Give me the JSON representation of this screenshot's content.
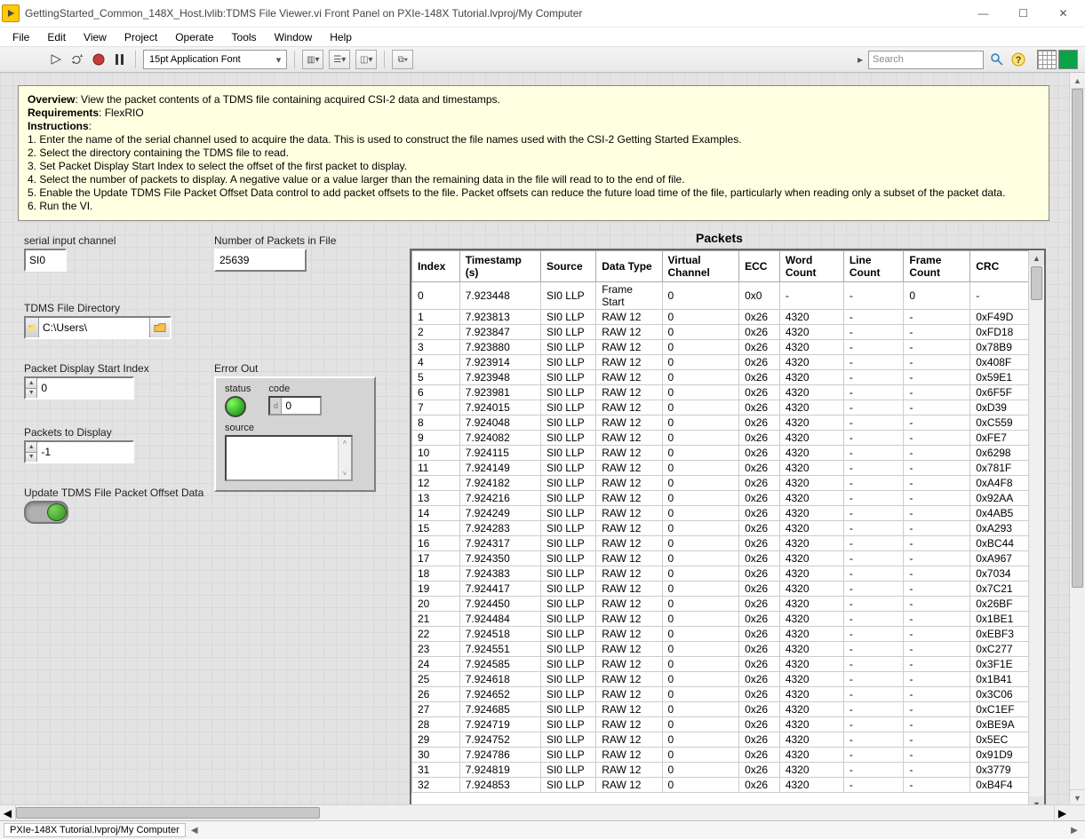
{
  "window": {
    "title": "GettingStarted_Common_148X_Host.lvlib:TDMS File Viewer.vi Front Panel on PXIe-148X Tutorial.lvproj/My Computer"
  },
  "menu": [
    "File",
    "Edit",
    "View",
    "Project",
    "Operate",
    "Tools",
    "Window",
    "Help"
  ],
  "toolbar": {
    "font": "15pt Application Font",
    "search_ph": "Search"
  },
  "overview": {
    "ov_line": "View the packet contents of a TDMS file containing acquired CSI-2 data and timestamps.",
    "req_line": "FlexRIO",
    "steps": [
      "1. Enter the name of the serial channel used to acquire the data.  This is used to construct the file names used with the CSI-2 Getting Started Examples.",
      "2. Select the directory containing the TDMS file to read.",
      "3. Set Packet Display Start Index to select the offset of the first packet to display.",
      "4. Select the number of packets to display.  A negative value or a value larger than the remaining data in the file will read to to the end of file.",
      "5. Enable the Update TDMS File Packet Offset Data control to add packet offsets to the file. Packet offsets can reduce the future load time of the file, particularly when reading only a subset of the packet data.",
      "6. Run the VI."
    ]
  },
  "labels": {
    "serial": "serial input channel",
    "numpkts": "Number of Packets in File",
    "tdmsdir": "TDMS File Directory",
    "startidx": "Packet Display Start Index",
    "pkts2disp": "Packets to Display",
    "update": "Update TDMS File Packet Offset Data",
    "errout": "Error Out",
    "status": "status",
    "code": "code",
    "source": "source",
    "packets": "Packets"
  },
  "values": {
    "serial": "SI0",
    "numpkts": "25639",
    "tdmsdir": "C:\\Users\\",
    "startidx": "0",
    "pkts2disp": "-1",
    "code": "0",
    "code_prefix": "d"
  },
  "table": {
    "headers": [
      "Index",
      "Timestamp (s)",
      "Source",
      "Data Type",
      "Virtual Channel",
      "ECC",
      "Word Count",
      "Line Count",
      "Frame Count",
      "CRC"
    ],
    "rows": [
      [
        "0",
        "7.923448",
        "SI0 LLP",
        "Frame Start",
        "0",
        "0x0",
        "-",
        "-",
        "0",
        "-"
      ],
      [
        "1",
        "7.923813",
        "SI0 LLP",
        "RAW 12",
        "0",
        "0x26",
        "4320",
        "-",
        "-",
        "0xF49D"
      ],
      [
        "2",
        "7.923847",
        "SI0 LLP",
        "RAW 12",
        "0",
        "0x26",
        "4320",
        "-",
        "-",
        "0xFD18"
      ],
      [
        "3",
        "7.923880",
        "SI0 LLP",
        "RAW 12",
        "0",
        "0x26",
        "4320",
        "-",
        "-",
        "0x78B9"
      ],
      [
        "4",
        "7.923914",
        "SI0 LLP",
        "RAW 12",
        "0",
        "0x26",
        "4320",
        "-",
        "-",
        "0x408F"
      ],
      [
        "5",
        "7.923948",
        "SI0 LLP",
        "RAW 12",
        "0",
        "0x26",
        "4320",
        "-",
        "-",
        "0x59E1"
      ],
      [
        "6",
        "7.923981",
        "SI0 LLP",
        "RAW 12",
        "0",
        "0x26",
        "4320",
        "-",
        "-",
        "0x6F5F"
      ],
      [
        "7",
        "7.924015",
        "SI0 LLP",
        "RAW 12",
        "0",
        "0x26",
        "4320",
        "-",
        "-",
        "0xD39"
      ],
      [
        "8",
        "7.924048",
        "SI0 LLP",
        "RAW 12",
        "0",
        "0x26",
        "4320",
        "-",
        "-",
        "0xC559"
      ],
      [
        "9",
        "7.924082",
        "SI0 LLP",
        "RAW 12",
        "0",
        "0x26",
        "4320",
        "-",
        "-",
        "0xFE7"
      ],
      [
        "10",
        "7.924115",
        "SI0 LLP",
        "RAW 12",
        "0",
        "0x26",
        "4320",
        "-",
        "-",
        "0x6298"
      ],
      [
        "11",
        "7.924149",
        "SI0 LLP",
        "RAW 12",
        "0",
        "0x26",
        "4320",
        "-",
        "-",
        "0x781F"
      ],
      [
        "12",
        "7.924182",
        "SI0 LLP",
        "RAW 12",
        "0",
        "0x26",
        "4320",
        "-",
        "-",
        "0xA4F8"
      ],
      [
        "13",
        "7.924216",
        "SI0 LLP",
        "RAW 12",
        "0",
        "0x26",
        "4320",
        "-",
        "-",
        "0x92AA"
      ],
      [
        "14",
        "7.924249",
        "SI0 LLP",
        "RAW 12",
        "0",
        "0x26",
        "4320",
        "-",
        "-",
        "0x4AB5"
      ],
      [
        "15",
        "7.924283",
        "SI0 LLP",
        "RAW 12",
        "0",
        "0x26",
        "4320",
        "-",
        "-",
        "0xA293"
      ],
      [
        "16",
        "7.924317",
        "SI0 LLP",
        "RAW 12",
        "0",
        "0x26",
        "4320",
        "-",
        "-",
        "0xBC44"
      ],
      [
        "17",
        "7.924350",
        "SI0 LLP",
        "RAW 12",
        "0",
        "0x26",
        "4320",
        "-",
        "-",
        "0xA967"
      ],
      [
        "18",
        "7.924383",
        "SI0 LLP",
        "RAW 12",
        "0",
        "0x26",
        "4320",
        "-",
        "-",
        "0x7034"
      ],
      [
        "19",
        "7.924417",
        "SI0 LLP",
        "RAW 12",
        "0",
        "0x26",
        "4320",
        "-",
        "-",
        "0x7C21"
      ],
      [
        "20",
        "7.924450",
        "SI0 LLP",
        "RAW 12",
        "0",
        "0x26",
        "4320",
        "-",
        "-",
        "0x26BF"
      ],
      [
        "21",
        "7.924484",
        "SI0 LLP",
        "RAW 12",
        "0",
        "0x26",
        "4320",
        "-",
        "-",
        "0x1BE1"
      ],
      [
        "22",
        "7.924518",
        "SI0 LLP",
        "RAW 12",
        "0",
        "0x26",
        "4320",
        "-",
        "-",
        "0xEBF3"
      ],
      [
        "23",
        "7.924551",
        "SI0 LLP",
        "RAW 12",
        "0",
        "0x26",
        "4320",
        "-",
        "-",
        "0xC277"
      ],
      [
        "24",
        "7.924585",
        "SI0 LLP",
        "RAW 12",
        "0",
        "0x26",
        "4320",
        "-",
        "-",
        "0x3F1E"
      ],
      [
        "25",
        "7.924618",
        "SI0 LLP",
        "RAW 12",
        "0",
        "0x26",
        "4320",
        "-",
        "-",
        "0x1B41"
      ],
      [
        "26",
        "7.924652",
        "SI0 LLP",
        "RAW 12",
        "0",
        "0x26",
        "4320",
        "-",
        "-",
        "0x3C06"
      ],
      [
        "27",
        "7.924685",
        "SI0 LLP",
        "RAW 12",
        "0",
        "0x26",
        "4320",
        "-",
        "-",
        "0xC1EF"
      ],
      [
        "28",
        "7.924719",
        "SI0 LLP",
        "RAW 12",
        "0",
        "0x26",
        "4320",
        "-",
        "-",
        "0xBE9A"
      ],
      [
        "29",
        "7.924752",
        "SI0 LLP",
        "RAW 12",
        "0",
        "0x26",
        "4320",
        "-",
        "-",
        "0x5EC"
      ],
      [
        "30",
        "7.924786",
        "SI0 LLP",
        "RAW 12",
        "0",
        "0x26",
        "4320",
        "-",
        "-",
        "0x91D9"
      ],
      [
        "31",
        "7.924819",
        "SI0 LLP",
        "RAW 12",
        "0",
        "0x26",
        "4320",
        "-",
        "-",
        "0x3779"
      ],
      [
        "32",
        "7.924853",
        "SI0 LLP",
        "RAW 12",
        "0",
        "0x26",
        "4320",
        "-",
        "-",
        "0xB4F4"
      ]
    ]
  },
  "statusbar": {
    "project": "PXIe-148X Tutorial.lvproj/My Computer"
  }
}
